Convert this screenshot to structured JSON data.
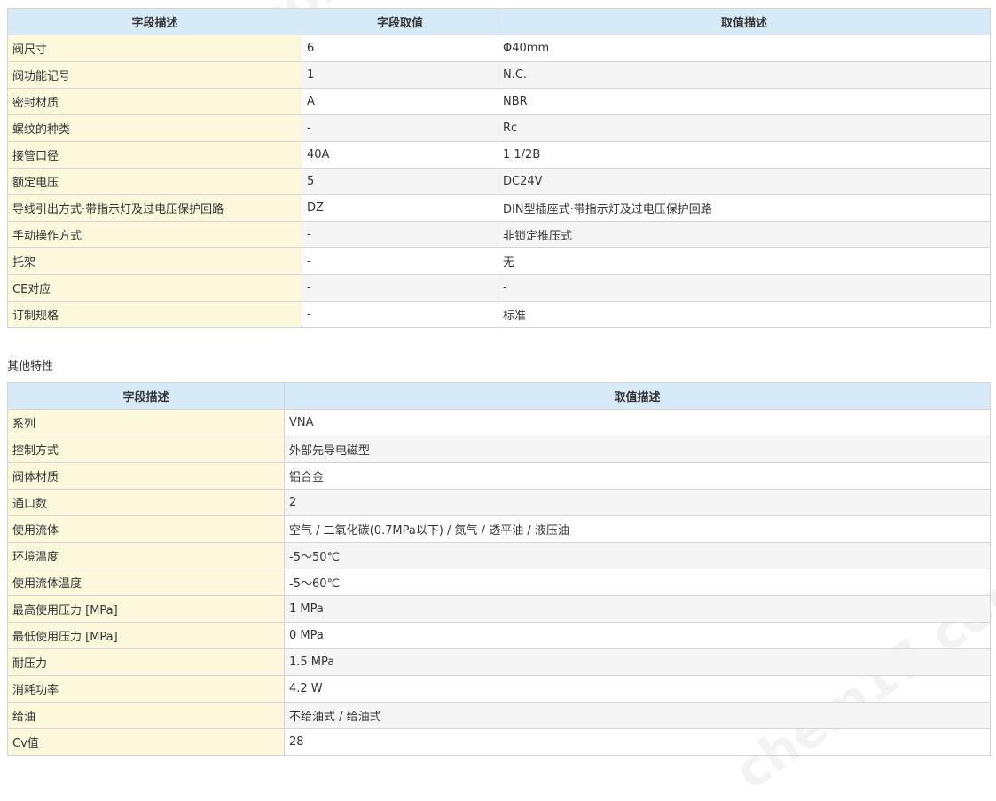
{
  "watermark": "chem17.com",
  "table1": {
    "headers": [
      "字段描述",
      "字段取值",
      "取值描述"
    ],
    "rows": [
      [
        "阀尺寸",
        "6",
        "Φ40mm"
      ],
      [
        "阀功能记号",
        "1",
        "N.C."
      ],
      [
        "密封材质",
        "A",
        "NBR"
      ],
      [
        "螺纹的种类",
        "-",
        "Rc"
      ],
      [
        "接管口径",
        "40A",
        "1 1/2B"
      ],
      [
        "额定电压",
        "5",
        "DC24V"
      ],
      [
        "导线引出方式·带指示灯及过电压保护回路",
        "DZ",
        "DIN型插座式·带指示灯及过电压保护回路"
      ],
      [
        "手动操作方式",
        "-",
        "非锁定推压式"
      ],
      [
        "托架",
        "-",
        "无"
      ],
      [
        "CE对应",
        "-",
        "-"
      ],
      [
        "订制规格",
        "-",
        "标准"
      ]
    ]
  },
  "section_title": "其他特性",
  "table2": {
    "headers": [
      "字段描述",
      "取值描述"
    ],
    "rows": [
      [
        "系列",
        "VNA"
      ],
      [
        "控制方式",
        "外部先导电磁型"
      ],
      [
        "阀体材质",
        "铝合金"
      ],
      [
        "通口数",
        "2"
      ],
      [
        "使用流体",
        "空气 / 二氧化碳(0.7MPa以下) / 氮气 / 透平油 / 液压油"
      ],
      [
        "环境温度",
        "-5～50℃"
      ],
      [
        "使用流体温度",
        "-5～60℃"
      ],
      [
        "最高使用压力 [MPa]",
        "1 MPa"
      ],
      [
        "最低使用压力 [MPa]",
        "0 MPa"
      ],
      [
        "耐压力",
        "1.5 MPa"
      ],
      [
        "消耗功率",
        "4.2 W"
      ],
      [
        "给油",
        "不给油式 / 给油式"
      ],
      [
        "Cv值",
        "28"
      ]
    ]
  },
  "colors": {
    "header_bg": "#d6eaf8",
    "field_bg": "#fcf8dc",
    "alt_row_bg": "#f5f5f5",
    "border": "#d4d4d4"
  }
}
